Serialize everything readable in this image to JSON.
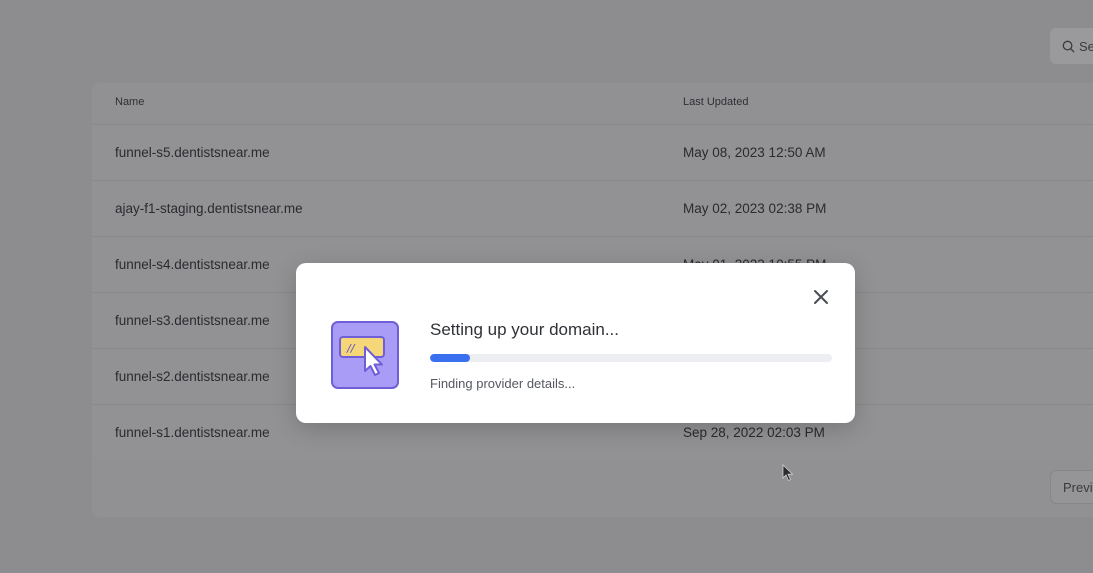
{
  "search": {
    "placeholder_partial": "Se"
  },
  "table": {
    "headers": {
      "name": "Name",
      "last_updated": "Last Updated"
    },
    "rows": [
      {
        "name": "funnel-s5.dentistsnear.me",
        "last_updated": "May 08, 2023 12:50 AM"
      },
      {
        "name": "ajay-f1-staging.dentistsnear.me",
        "last_updated": "May 02, 2023 02:38 PM"
      },
      {
        "name": "funnel-s4.dentistsnear.me",
        "last_updated": "May 01, 2023 10:55 PM"
      },
      {
        "name": "funnel-s3.dentistsnear.me",
        "last_updated": ""
      },
      {
        "name": "funnel-s2.dentistsnear.me",
        "last_updated": ""
      },
      {
        "name": "funnel-s1.dentistsnear.me",
        "last_updated": "Sep 28, 2022 02:03 PM"
      }
    ]
  },
  "pagination": {
    "previous_partial": "Previ"
  },
  "modal": {
    "title": "Setting up your domain...",
    "status": "Finding provider details...",
    "progress": 0.1,
    "close_icon": "close-icon",
    "illustration_icon": "domain-cursor-illustration",
    "accent_color": "#3a6ff0"
  }
}
